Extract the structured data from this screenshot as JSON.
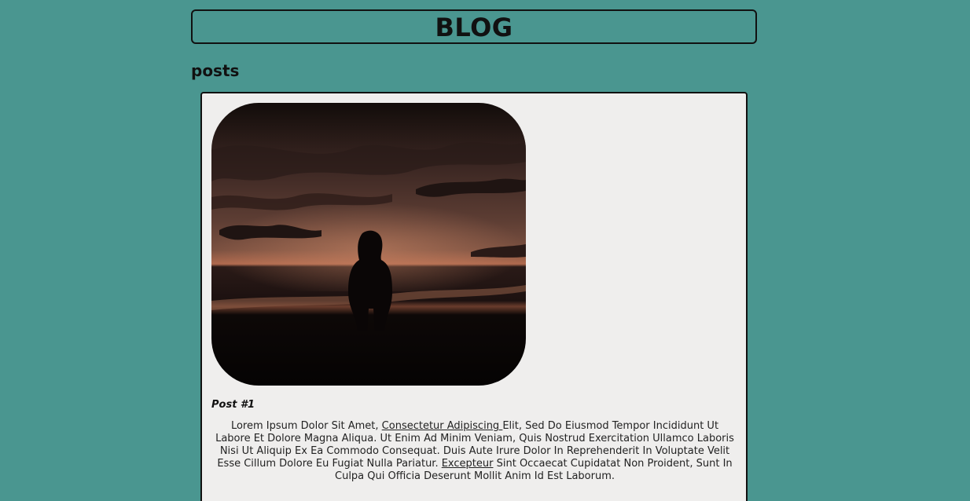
{
  "header": {
    "title": "BLOG"
  },
  "posts_section": {
    "heading": "posts"
  },
  "posts": [
    {
      "title": "Post #1",
      "image": {
        "description_icon": "photo-silhouette-sunset"
      },
      "body": {
        "text_1": "Lorem Ipsum Dolor Sit Amet, ",
        "link_1": "Consectetur Adipiscing ",
        "text_2": "Elit, Sed Do Eiusmod Tempor Incididunt Ut Labore Et Dolore Magna Aliqua. Ut Enim Ad Minim Veniam, Quis Nostrud Exercitation Ullamco Laboris Nisi Ut Aliquip Ex Ea Commodo Consequat. Duis Aute Irure Dolor In Reprehenderit In Voluptate Velit Esse Cillum Dolore Eu Fugiat Nulla Pariatur. ",
        "link_2": "Excepteur",
        "text_3": " Sint Occaecat Cupidatat Non Proident, Sunt In Culpa Qui Officia Deserunt Mollit Anim Id Est Laborum."
      }
    }
  ],
  "colors": {
    "page_background": "#4a9690",
    "card_background": "#efeeed",
    "border": "#111111",
    "text": "#222222"
  }
}
